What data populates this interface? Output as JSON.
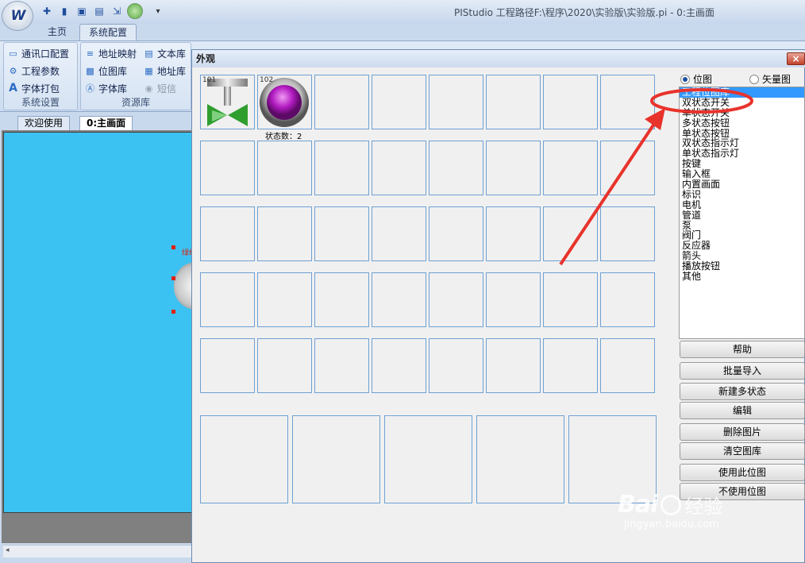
{
  "app": {
    "title": "PIStudio    工程路径F:\\程序\\2020\\实验版\\实验版.pi    - 0:主画面"
  },
  "ribbon": {
    "tabs": [
      {
        "label": "主页"
      },
      {
        "label": "系统配置"
      }
    ],
    "groups": {
      "system": {
        "label": "系统设置",
        "items": [
          {
            "label": "通讯口配置"
          },
          {
            "label": "工程参数"
          },
          {
            "label": "字体打包"
          }
        ]
      },
      "resources": {
        "label": "资源库",
        "col1": [
          {
            "label": "地址映射"
          },
          {
            "label": "位图库"
          },
          {
            "label": "字体库"
          }
        ],
        "col2": [
          {
            "label": "文本库"
          },
          {
            "label": "地址库"
          },
          {
            "label": "短信"
          }
        ]
      }
    }
  },
  "doc_tabs": [
    {
      "label": "欢迎使用"
    },
    {
      "label": "0:主画面"
    }
  ],
  "canvas": {
    "element_label": "绿线"
  },
  "dialog": {
    "title": "外观",
    "close_glyph": "×",
    "cells": [
      {
        "label": "101"
      },
      {
        "label": "102",
        "caption": "状态数：2"
      }
    ],
    "radios": [
      {
        "label": "位图",
        "checked": true
      },
      {
        "label": "矢量图",
        "checked": false
      }
    ],
    "list": [
      "工程位图库",
      "双状态开关",
      "单状态开关",
      "多状态按钮",
      "单状态按钮",
      "双状态指示灯",
      "单状态指示灯",
      "按键",
      "输入框",
      "内置画面",
      "标识",
      "电机",
      "管道",
      "泵",
      "阀门",
      "反应器",
      "箭头",
      "播放按钮",
      "其他"
    ],
    "list_selected": 0,
    "buttons": [
      {
        "label": "帮助"
      },
      {
        "label": "批量导入"
      },
      {
        "label": "新建多状态"
      },
      {
        "label": "编辑"
      },
      {
        "label": "删除图片"
      },
      {
        "label": "清空图库"
      },
      {
        "label": "使用此位图"
      },
      {
        "label": "不使用位图"
      }
    ]
  },
  "watermark": {
    "brand": "Bai",
    "brand2": "经验",
    "url": "jingyan.baidu.com"
  }
}
